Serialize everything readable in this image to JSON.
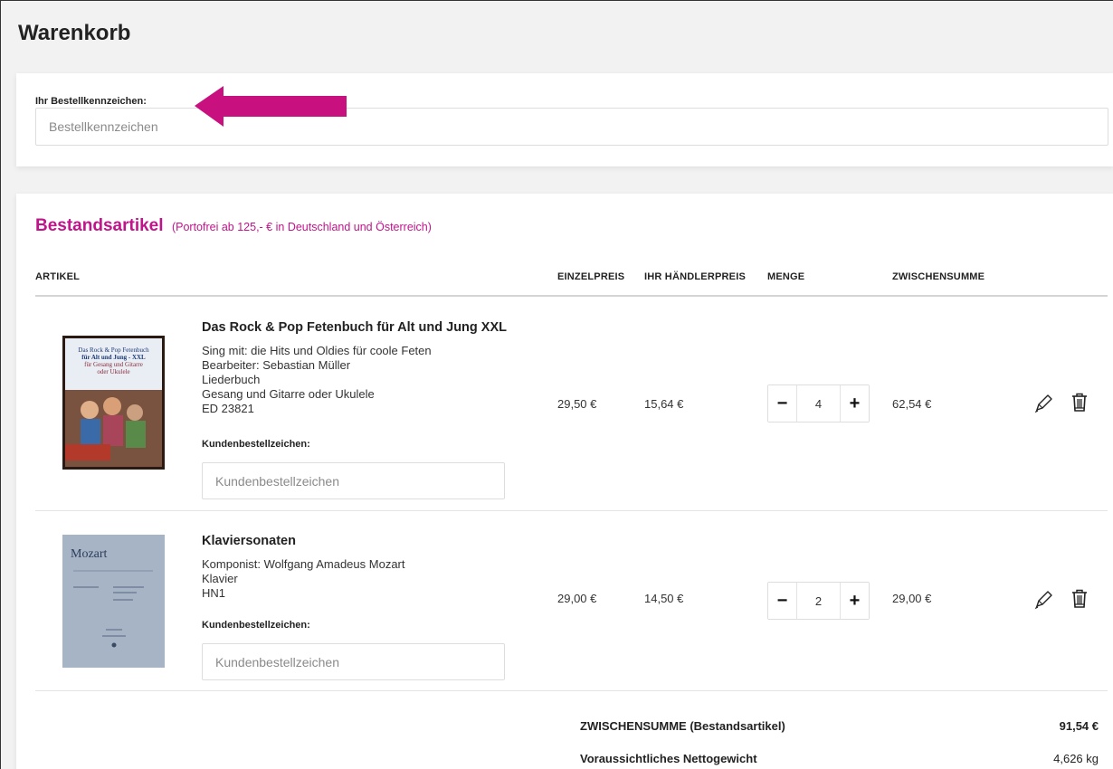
{
  "page": {
    "title": "Warenkorb"
  },
  "order": {
    "label": "Ihr Bestellkennzeichen:",
    "placeholder": "Bestellkennzeichen",
    "value": ""
  },
  "section": {
    "title": "Bestandsartikel",
    "note": "(Portofrei ab 125,- € in Deutschland und Österreich)"
  },
  "columns": {
    "artikel": "ARTIKEL",
    "einzelpreis": "EINZELPREIS",
    "haendlerpreis": "IHR HÄNDLERPREIS",
    "menge": "MENGE",
    "zwischensumme": "ZWISCHENSUMME"
  },
  "items": [
    {
      "title": "Das Rock & Pop Fetenbuch für Alt und Jung XXL",
      "lines": [
        "Sing mit: die Hits und Oldies für coole Feten",
        "Bearbeiter: Sebastian Müller",
        "Liederbuch",
        "Gesang und Gitarre oder Ukulele",
        "ED 23821"
      ],
      "customer_label": "Kundenbestellzeichen:",
      "customer_placeholder": "Kundenbestellzeichen",
      "einzelpreis": "29,50 €",
      "haendlerpreis": "15,64 €",
      "menge": "4",
      "zwischensumme": "62,54 €",
      "cover_text": [
        "Das Rock & Pop Fetenbuch",
        "für Alt und Jung - XXL",
        "für Gesang und Gitarre",
        "oder Ukulele"
      ]
    },
    {
      "title": "Klaviersonaten",
      "lines": [
        "Komponist: Wolfgang Amadeus Mozart",
        "Klavier",
        "HN1"
      ],
      "customer_label": "Kundenbestellzeichen:",
      "customer_placeholder": "Kundenbestellzeichen",
      "einzelpreis": "29,00 €",
      "haendlerpreis": "14,50 €",
      "menge": "2",
      "zwischensumme": "29,00 €",
      "cover_text": [
        "Mozart"
      ]
    }
  ],
  "stepper": {
    "minus": "−",
    "plus": "+"
  },
  "summary": {
    "subtotal_label": "ZWISCHENSUMME (Bestandsartikel)",
    "subtotal_value": "91,54 €",
    "weight_label": "Voraussichtliches Nettogewicht",
    "weight_value": "4,626 kg"
  },
  "colors": {
    "accent": "#c0148a"
  }
}
